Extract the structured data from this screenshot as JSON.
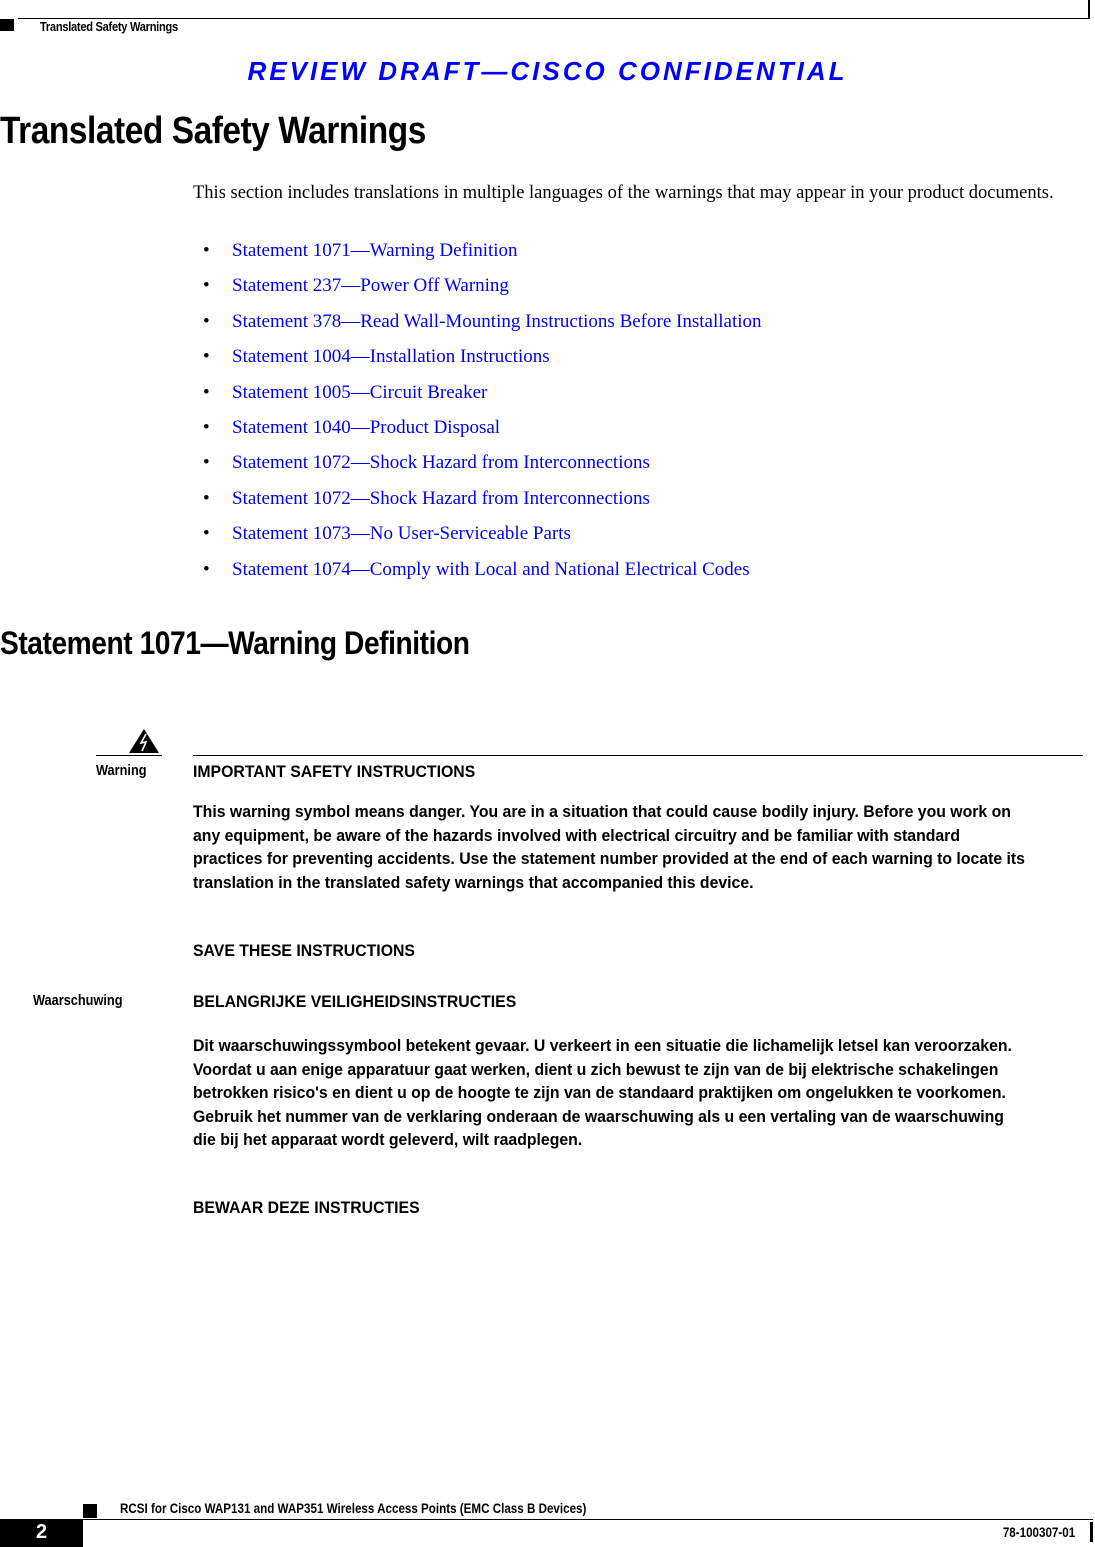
{
  "header": {
    "section_title": "Translated Safety Warnings",
    "draft_banner": "REVIEW DRAFT—CISCO CONFIDENTIAL"
  },
  "page_title": "Translated Safety Warnings",
  "intro": "This section includes translations in multiple languages of the warnings that may appear in your product documents.",
  "links": [
    {
      "label": "Statement 1071—Warning Definition"
    },
    {
      "label": "Statement 237—Power Off Warning"
    },
    {
      "label": "Statement 378—Read Wall-Mounting Instructions Before Installation"
    },
    {
      "label": "Statement 1004—Installation Instructions"
    },
    {
      "label": "Statement 1005—Circuit Breaker"
    },
    {
      "label": "Statement 1040—Product Disposal"
    },
    {
      "label": "Statement 1072—Shock Hazard from Interconnections"
    },
    {
      "label": "Statement 1072—Shock Hazard from Interconnections"
    },
    {
      "label": "Statement 1073—No User-Serviceable Parts"
    },
    {
      "label": "Statement 1074—Comply with Local and National Electrical Codes"
    }
  ],
  "link_color": "#0000ee",
  "banner_color": "#0000ff",
  "section": {
    "title": "Statement 1071—Warning Definition",
    "icon": "warning-triangle-lightning-icon",
    "warnings": [
      {
        "language_label": "Warning",
        "heading": "IMPORTANT SAFETY INSTRUCTIONS",
        "body": "This warning symbol means danger. You are in a situation that could cause bodily injury. Before you work on any equipment, be aware of the hazards involved with electrical circuitry and be familiar with standard practices for preventing accidents. Use the statement number provided at the end of each warning to locate its translation in the translated safety warnings that accompanied this device.",
        "footer": "SAVE THESE INSTRUCTIONS"
      },
      {
        "language_label": "Waarschuwing",
        "heading": "BELANGRIJKE VEILIGHEIDSINSTRUCTIES",
        "body": "Dit waarschuwingssymbool betekent gevaar. U verkeert in een situatie die lichamelijk letsel kan veroorzaken. Voordat u aan enige apparatuur gaat werken, dient u zich bewust te zijn van de bij elektrische schakelingen betrokken risico's en dient u op de hoogte te zijn van de standaard praktijken om ongelukken te voorkomen. Gebruik het nummer van de verklaring onderaan de waarschuwing als u een vertaling van de waarschuwing die bij het apparaat wordt geleverd, wilt raadplegen.",
        "footer": "BEWAAR DEZE INSTRUCTIES"
      }
    ]
  },
  "footer": {
    "doc_title": "RCSI for Cisco WAP131 and WAP351 Wireless Access Points (EMC Class B Devices)",
    "page_number": "2",
    "doc_number": "78-100307-01"
  }
}
